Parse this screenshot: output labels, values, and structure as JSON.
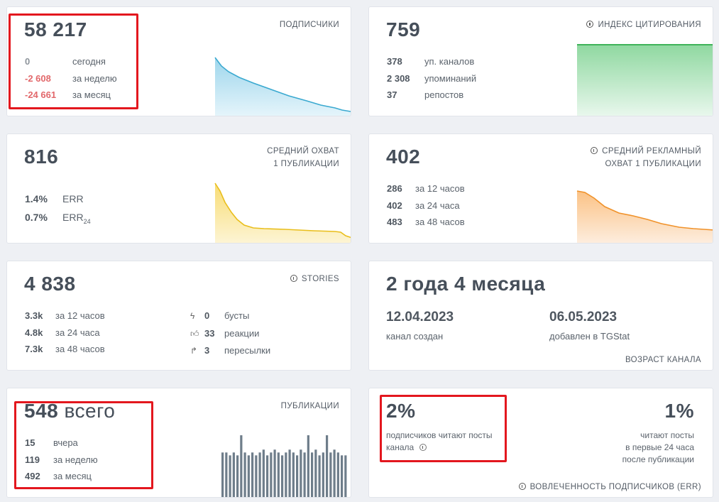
{
  "subscribers": {
    "value": "58 217",
    "label": "ПОДПИСЧИКИ",
    "rows": [
      {
        "v": "0",
        "t": "сегодня"
      },
      {
        "v": "-2 608",
        "t": "за неделю"
      },
      {
        "v": "-24 661",
        "t": "за месяц"
      }
    ],
    "chart_color": "#3aa9d0"
  },
  "citation": {
    "value": "759",
    "label": "ИНДЕКС ЦИТИРОВАНИЯ",
    "icon": "info-icon",
    "rows": [
      {
        "v": "378",
        "t": "уп. каналов"
      },
      {
        "v": "2 308",
        "t": "упоминаний"
      },
      {
        "v": "37",
        "t": "репостов"
      }
    ],
    "chart_color": "#3fb35a"
  },
  "reach": {
    "value": "816",
    "label_line1": "СРЕДНИЙ ОХВАТ",
    "label_line2": "1 ПУБЛИКАЦИИ",
    "err": {
      "v": "1.4%",
      "t": "ERR"
    },
    "err24": {
      "v": "0.7%",
      "t": "ERR",
      "sub": "24"
    },
    "chart_color": "#e9be1c"
  },
  "ad_reach": {
    "value": "402",
    "label_line1": "СРЕДНИЙ РЕКЛАМНЫЙ",
    "label_line2": "ОХВАТ 1 ПУБЛИКАЦИИ",
    "icon": "info-icon",
    "rows": [
      {
        "v": "286",
        "t": "за 12 часов"
      },
      {
        "v": "402",
        "t": "за 24 часа"
      },
      {
        "v": "483",
        "t": "за 48 часов"
      }
    ],
    "chart_color": "#f0922a"
  },
  "stories": {
    "value": "4 838",
    "label": "STORIES",
    "icon": "info-icon",
    "rows": [
      {
        "v": "3.3k",
        "t": "за 12 часов"
      },
      {
        "v": "4.8k",
        "t": "за 24 часа"
      },
      {
        "v": "7.3k",
        "t": "за 48 часов"
      }
    ],
    "extras": [
      {
        "icon": "lightning-icon",
        "v": "0",
        "t": "бусты"
      },
      {
        "icon": "thumbs-up-icon",
        "v": "33",
        "t": "реакции"
      },
      {
        "icon": "forward-arrow-icon",
        "v": "3",
        "t": "пересылки"
      }
    ]
  },
  "age": {
    "value": "2 года 4 месяца",
    "created_date": "12.04.2023",
    "created_label": "канал создан",
    "added_date": "06.05.2023",
    "added_label": "добавлен в TGStat",
    "label": "ВОЗРАСТ КАНАЛА"
  },
  "publications": {
    "value": "548",
    "value_suffix": "всего",
    "label": "ПУБЛИКАЦИИ",
    "rows": [
      {
        "v": "15",
        "t": "вчера"
      },
      {
        "v": "119",
        "t": "за неделю"
      },
      {
        "v": "492",
        "t": "за месяц"
      }
    ],
    "bar_values": [
      16,
      16,
      15,
      16,
      15,
      22,
      16,
      15,
      16,
      15,
      16,
      17,
      15,
      16,
      17,
      16,
      15,
      16,
      17,
      16,
      15,
      17,
      16,
      22,
      16,
      17,
      15,
      16,
      22,
      16,
      17,
      16,
      15,
      15
    ]
  },
  "engagement": {
    "left_value": "2%",
    "left_line1": "подписчиков читают посты",
    "left_line2": "канала",
    "right_value": "1%",
    "right_line1": "читают посты",
    "right_line2": "в первые 24 часа",
    "right_line3": "после публикации",
    "label": "ВОВЛЕЧЕННОСТЬ ПОДПИСЧИКОВ (ERR)",
    "icon": "info-icon"
  }
}
